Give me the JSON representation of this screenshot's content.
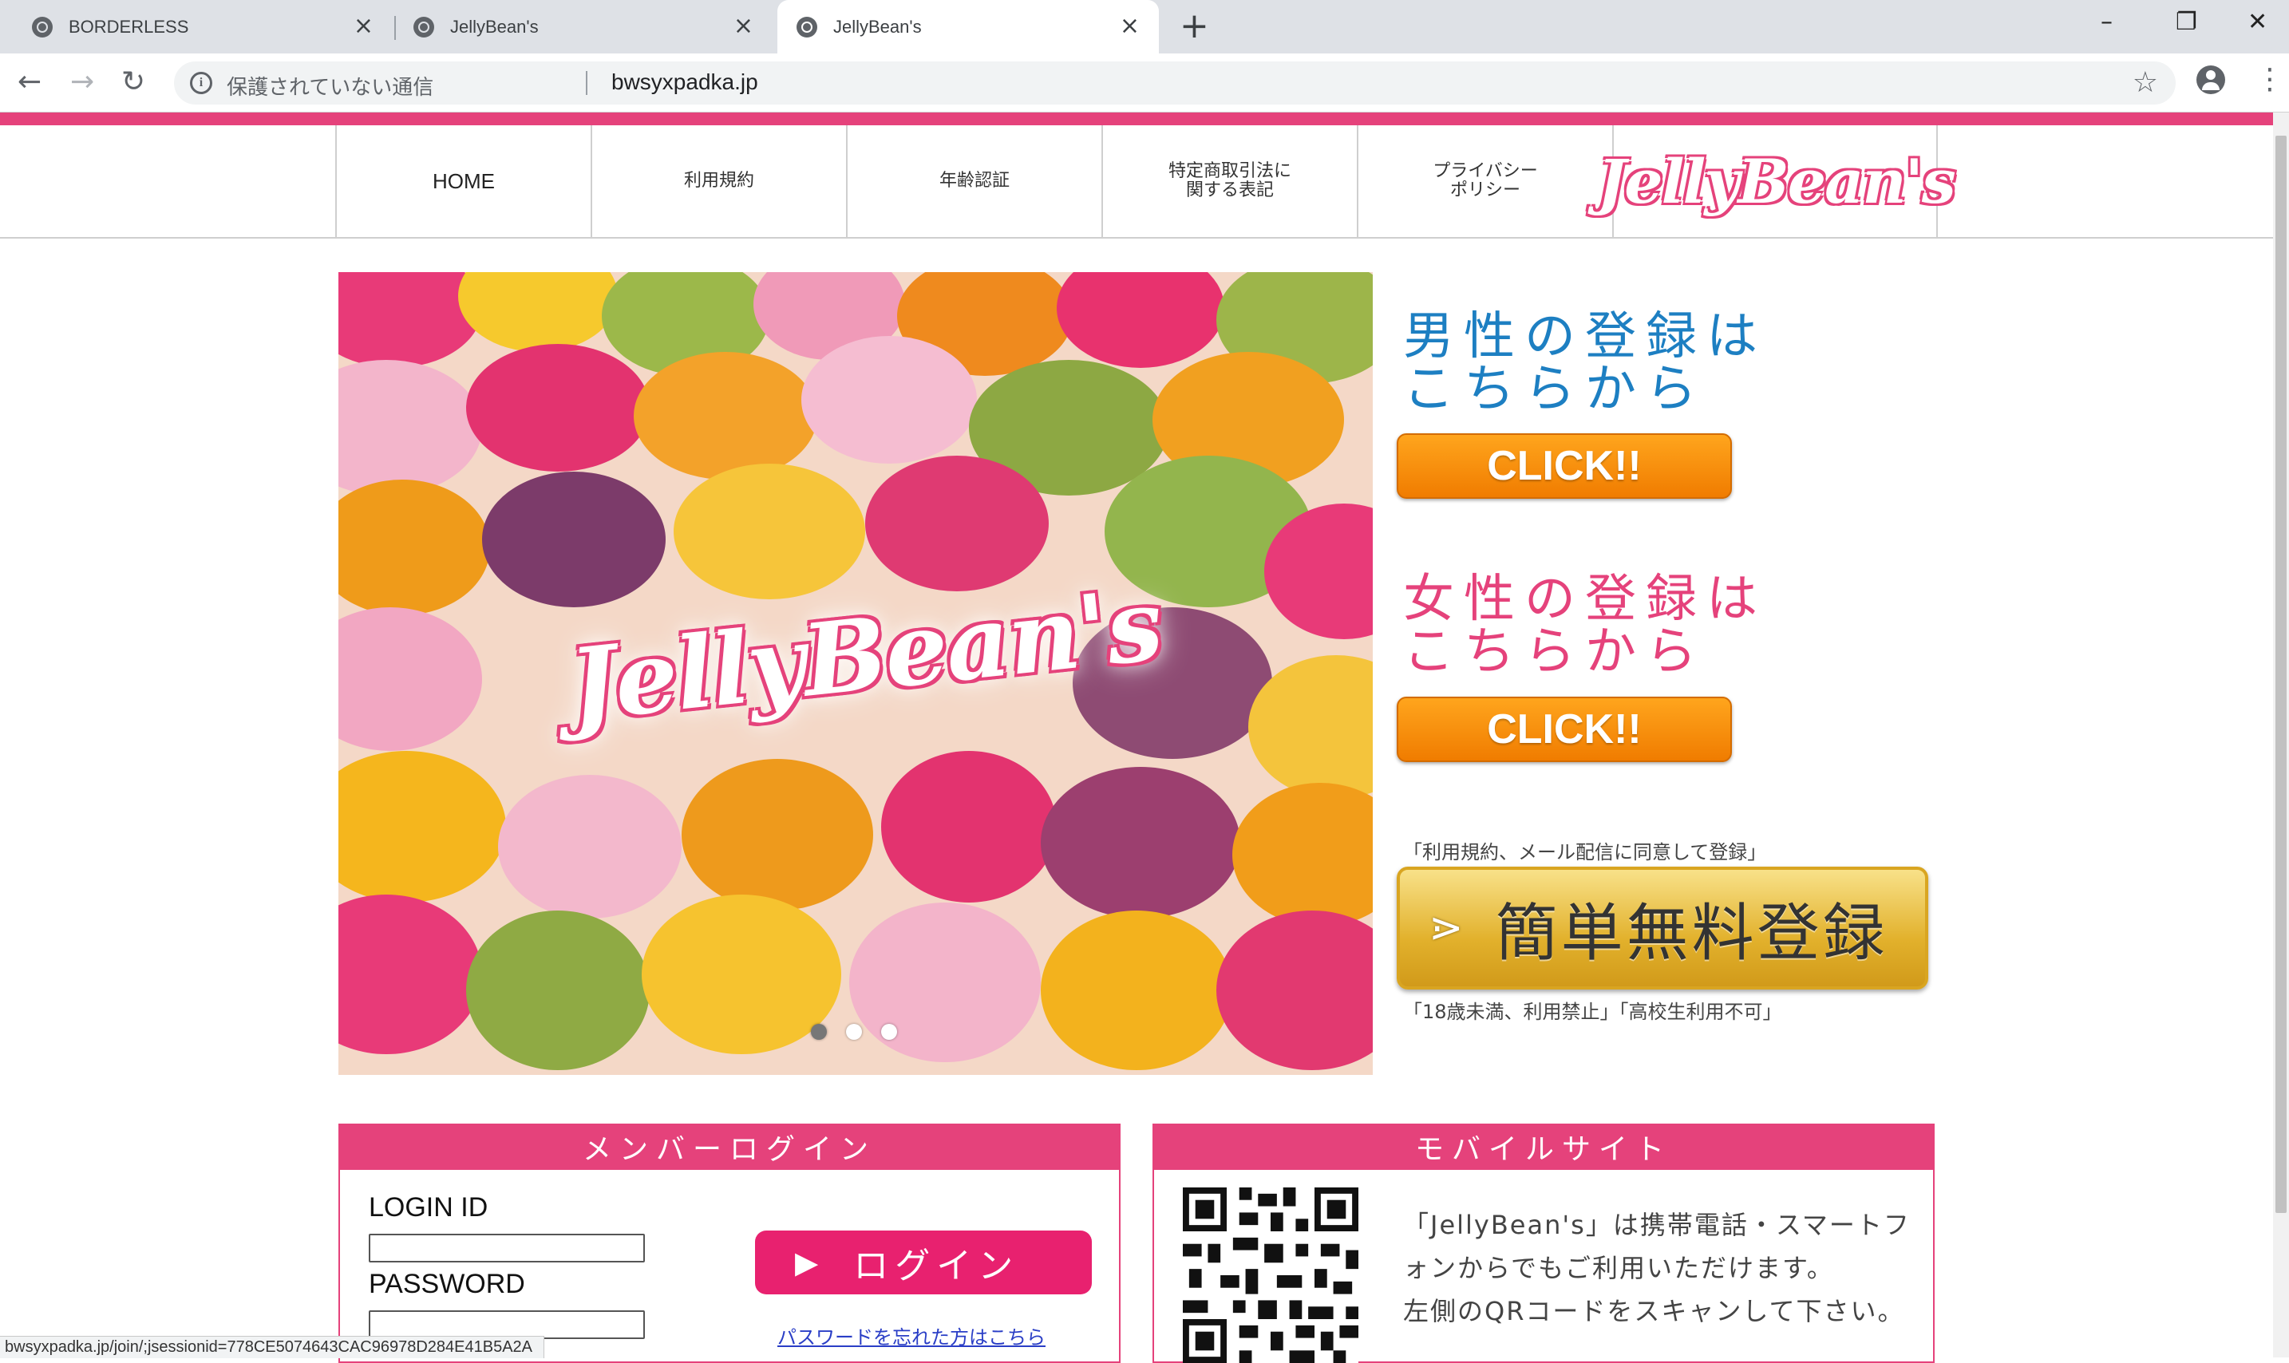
{
  "browser": {
    "tabs": [
      {
        "title": "BORDERLESS"
      },
      {
        "title": "JellyBean's"
      },
      {
        "title": "JellyBean's"
      }
    ],
    "security_text": "保護されていない通信",
    "url": "bwsyxpadka.jp",
    "status_url": "bwsyxpadka.jp/join/;jsessionid=778CE5074643CAC96978D284E41B5A2A"
  },
  "nav": {
    "items": [
      {
        "label": "HOME"
      },
      {
        "label": "利用規約"
      },
      {
        "label": "年齢認証"
      },
      {
        "label": "特定商取引法に\n関する表記"
      },
      {
        "label": "プライバシー\nポリシー"
      }
    ],
    "logo_text": "JellyBean's"
  },
  "hero": {
    "logo_text": "JellyBean's",
    "slide_count": 3,
    "active_slide": 0
  },
  "register": {
    "male_heading": "男性の登録は\nこちらから",
    "male_button": "CLICK!!",
    "female_heading": "女性の登録は\nこちらから",
    "female_button": "CLICK!!",
    "consent": "「利用規約、メール配信に同意して登録」",
    "free_button": "簡単無料登録",
    "notice": "「18歳未満、利用禁止」「高校生利用不可」"
  },
  "login": {
    "heading": "メンバーログイン",
    "id_label": "LOGIN ID",
    "id_value": "",
    "password_label": "PASSWORD",
    "password_value": "",
    "button": "ログイン",
    "forgot": "パスワードを忘れた方はこちら"
  },
  "mobile": {
    "heading": "モバイルサイト",
    "text": "「JellyBean's」は携帯電話・スマートフ\nォンからでもご利用いただけます。\n左側のQRコードをスキャンして下さい。"
  },
  "colors": {
    "brand_pink": "#e5427b",
    "male_blue": "#1d7fc2",
    "click_orange": "#f7931e",
    "gold": "#e2b12c"
  }
}
